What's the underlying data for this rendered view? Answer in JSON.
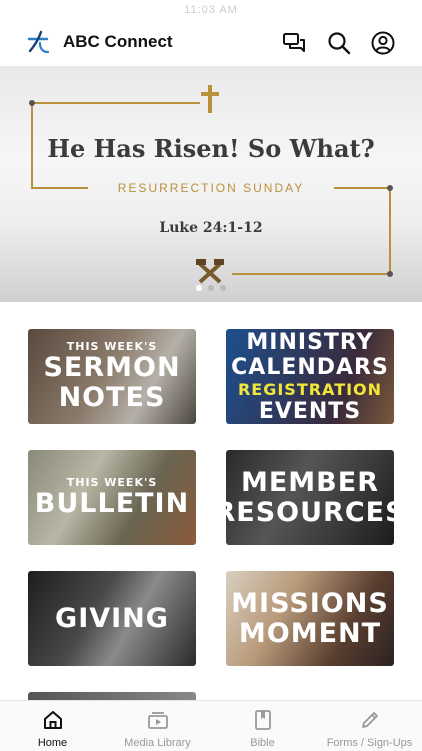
{
  "status_bar": {
    "time": "11:03 AM"
  },
  "header": {
    "title": "ABC Connect",
    "icons": [
      "logo-icon",
      "chat-icon",
      "search-icon",
      "profile-icon"
    ]
  },
  "hero": {
    "title": "He Has Risen! So What?",
    "subtitle": "RESURRECTION SUNDAY",
    "reference": "Luke 24:1-12",
    "slide_count": 3,
    "active_slide": 1
  },
  "tiles": {
    "sermon_notes": {
      "line1": "THIS WEEK'S",
      "line2": "SERMON",
      "line3": "NOTES"
    },
    "ministry": {
      "line1": "MINISTRY",
      "line2": "CALENDARS",
      "line3": "REGISTRATION",
      "line4": "EVENTS"
    },
    "bulletin": {
      "line1": "THIS WEEK'S",
      "line2": "BULLETIN"
    },
    "member": {
      "line1": "MEMBER",
      "line2": "RESOURCES"
    },
    "giving": {
      "line1": "GIVING"
    },
    "missions": {
      "line1": "MISSIONS",
      "line2": "MOMENT"
    }
  },
  "tab_bar": {
    "home": "Home",
    "media": "Media Library",
    "bible": "Bible",
    "forms": "Forms / Sign-Ups",
    "active": "Home"
  },
  "colors": {
    "accent_gold": "#b9913d",
    "highlight_yellow": "#f3e63a"
  }
}
